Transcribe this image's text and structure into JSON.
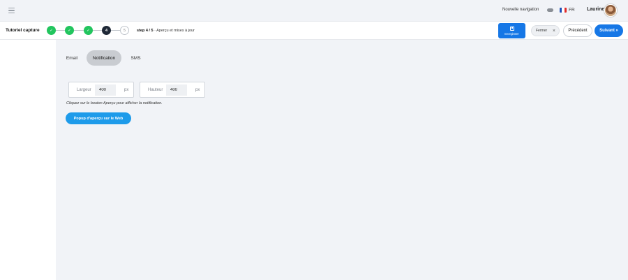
{
  "topbar": {
    "nav_toggle_label": "Nouvelle navigation",
    "language": "FR",
    "user_name": "Laurine"
  },
  "wizard": {
    "title": "Tutoriel capture",
    "steps": [
      {
        "label": "✓",
        "state": "done"
      },
      {
        "label": "✓",
        "state": "done"
      },
      {
        "label": "✓",
        "state": "done"
      },
      {
        "label": "4",
        "state": "current"
      },
      {
        "label": "5",
        "state": "todo"
      }
    ],
    "step_prefix": "step 4 / 5",
    "step_name": "Aperçu et mises à jour",
    "save_label": "Enregistrer",
    "close_label": "Fermer",
    "close_icon": "×",
    "prev_label": "Précédent",
    "next_label": "Suivant »"
  },
  "tabs": [
    {
      "label": "Email",
      "active": false
    },
    {
      "label": "Notification",
      "active": true
    },
    {
      "label": "SMS",
      "active": false
    }
  ],
  "fields": {
    "width": {
      "label": "Largeur",
      "value": "400",
      "unit": "px"
    },
    "height": {
      "label": "Hauteur",
      "value": "400",
      "unit": "px"
    }
  },
  "hint": "Cliquez sur le bouton Aperçu pour afficher la notification.",
  "preview_button": "Popup d'aperçu sur le Web",
  "colors": {
    "primary": "#1677e6",
    "preview": "#1e9bea",
    "done": "#22c55e",
    "current": "#1f2937"
  }
}
